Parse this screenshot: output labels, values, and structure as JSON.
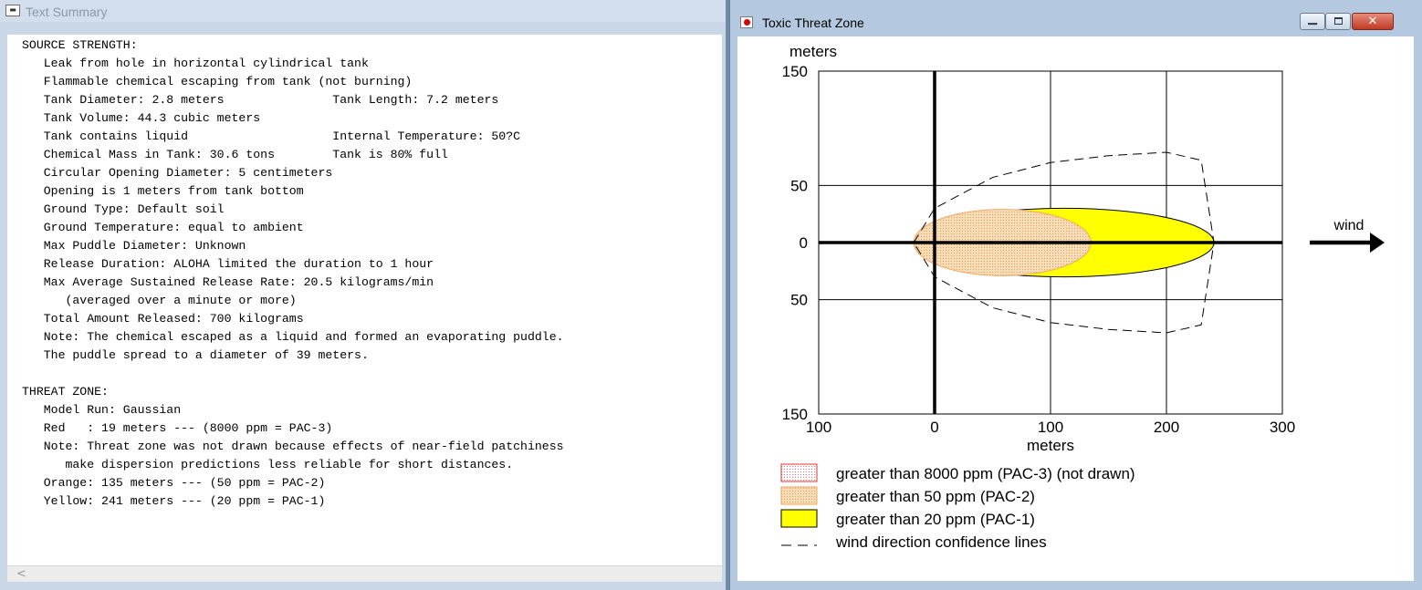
{
  "left_window": {
    "title": "Text Summary",
    "icon": "text-document-icon",
    "scroll_left_glyph": "<",
    "lines": [
      "SOURCE STRENGTH:",
      "   Leak from hole in horizontal cylindrical tank",
      "   Flammable chemical escaping from tank (not burning)",
      "   Tank Diameter: 2.8 meters               Tank Length: 7.2 meters",
      "   Tank Volume: 44.3 cubic meters",
      "   Tank contains liquid                    Internal Temperature: 50?C",
      "   Chemical Mass in Tank: 30.6 tons        Tank is 80% full",
      "   Circular Opening Diameter: 5 centimeters",
      "   Opening is 1 meters from tank bottom",
      "   Ground Type: Default soil",
      "   Ground Temperature: equal to ambient",
      "   Max Puddle Diameter: Unknown",
      "   Release Duration: ALOHA limited the duration to 1 hour",
      "   Max Average Sustained Release Rate: 20.5 kilograms/min",
      "      (averaged over a minute or more)",
      "   Total Amount Released: 700 kilograms",
      "   Note: The chemical escaped as a liquid and formed an evaporating puddle.",
      "   The puddle spread to a diameter of 39 meters.",
      "",
      "THREAT ZONE:",
      "   Model Run: Gaussian",
      "   Red   : 19 meters --- (8000 ppm = PAC-3)",
      "   Note: Threat zone was not drawn because effects of near-field patchiness",
      "      make dispersion predictions less reliable for short distances.",
      "   Orange: 135 meters --- (50 ppm = PAC-2)",
      "   Yellow: 241 meters --- (20 ppm = PAC-1)"
    ]
  },
  "right_window": {
    "title": "Toxic Threat Zone",
    "icon": "aloha-app-icon",
    "controls": {
      "minimize_glyph": "▁",
      "maximize_icon": "maximize-icon",
      "close_glyph": "✕"
    }
  },
  "chart_data": {
    "type": "area",
    "title": "",
    "xlabel": "meters",
    "ylabel": "meters",
    "xlim": [
      -100,
      300
    ],
    "ylim": [
      -150,
      150
    ],
    "x_ticks": [
      -100,
      0,
      100,
      200,
      300
    ],
    "x_tick_labels": [
      "100",
      "0",
      "100",
      "200",
      "300"
    ],
    "y_ticks": [
      150,
      50,
      0,
      -50,
      -150
    ],
    "y_tick_labels": [
      "150",
      "50",
      "0",
      "50",
      "150"
    ],
    "grid": true,
    "wind_label": "wind",
    "zones": [
      {
        "name": "orange",
        "color": "#f7ddb6",
        "outline": "#f4a460",
        "pattern": "dotted",
        "x_min": -18,
        "x_max": 135,
        "half_width": 29
      },
      {
        "name": "yellow",
        "color": "#ffff00",
        "outline": "#000000",
        "x_min": -18,
        "x_max": 241,
        "half_width": 30
      }
    ],
    "confidence_lines": [
      {
        "x": -18,
        "y": 0
      },
      {
        "x": 0,
        "y": 30
      },
      {
        "x": 50,
        "y": 57
      },
      {
        "x": 100,
        "y": 70
      },
      {
        "x": 150,
        "y": 76
      },
      {
        "x": 200,
        "y": 79
      },
      {
        "x": 230,
        "y": 72
      },
      {
        "x": 241,
        "y": 0
      },
      {
        "x": 230,
        "y": -72
      },
      {
        "x": 200,
        "y": -79
      },
      {
        "x": 150,
        "y": -76
      },
      {
        "x": 100,
        "y": -70
      },
      {
        "x": 50,
        "y": -57
      },
      {
        "x": 0,
        "y": -30
      },
      {
        "x": -18,
        "y": 0
      }
    ],
    "legend": [
      {
        "label": "greater than 8000 ppm (PAC-3) (not drawn)",
        "swatch": "red-dotted"
      },
      {
        "label": "greater than 50 ppm (PAC-2)",
        "swatch": "orange-dotted"
      },
      {
        "label": "greater than 20 ppm (PAC-1)",
        "swatch": "yellow"
      },
      {
        "label": "wind direction confidence lines",
        "swatch": "dashed-line"
      }
    ],
    "colors": {
      "pac3_outline": "#e83030",
      "pac2_fill": "#f7ddb6",
      "pac2_outline": "#f4a460",
      "pac1_fill": "#ffff00"
    }
  }
}
